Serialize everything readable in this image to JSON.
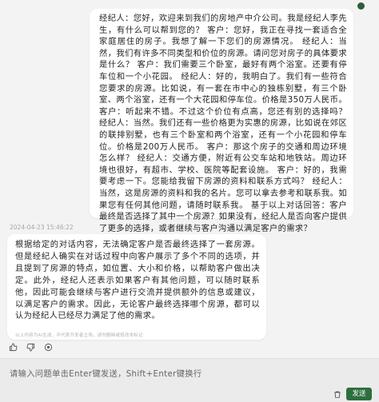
{
  "chat": {
    "user_message": "经纪人：您好，欢迎来到我们的房地产中介公司。我是经纪人李先生，有什么可以帮到您的？ 客户：您好，我正在寻找一套适合全家庭居住的房子。我想了解一下您们的房源情况。 经纪人：当然，我们有许多不同类型和价位的房源。请问您对房子的具体要求是什么？ 客户：我们需要三个卧室，最好有两个浴室。还要有停车位和一个小花园。 经纪人：好的，我明白了。我们有一些符合您要求的房源。比如说，有一套在市中心的独栋别墅，有三个卧室、两个浴室，还有一个大花园和停车位。价格是350万人民币。 客户：听起来不错。不过这个价位有点高，您还有别的选择吗？ 经纪人：当然。我们还有一些价格更为实惠的房源，比如说在郊区的联排别墅，也有三个卧室和两个浴室，还有一个小花园和停车位。价格是200万人民币。 客户：那这个房子的交通和周边环境怎么样？ 经纪人：交通方便，附近有公交车站和地铁站。周边环境也很好，有超市、学校、医院等配套设施。 客户：好的，我需要考虑一下。您能给我留下房源的资料和联系方式吗？ 经纪人：当然，这是房源的资料和我的名片。您可以拿去参考和联系我。如果您有任何其他问题，请随时联系我。 基于以上对话回答：客户最终是否选择了其中一个房源？如果没有，经纪人是否向客户提供了更多的选择，或者继续与客户沟通以满足客户的需求？",
    "timestamp": "2024-04-23 15:46:22",
    "ai_message": "根据给定的对话内容，无法确定客户是否最终选择了一套房源。但是经纪人确实在对话过程中向客户展示了多个不同的选项，并且提到了房源的特点，如位置、大小和价格，以帮助客户做出决定。此外，经纪人还表示如果客户有其他问题，可以随时联系他，因此可能会继续与客户进行交流并提供额外的信息或建议，以满足客户的需求。因此，无论客户最终选择哪个房源，都可以认为经纪人已经尽力满足了他的需求。",
    "disclaimer": "以上内容为AI生成，不代表开发者立场，请勿删除或修改本标记"
  },
  "actions": {
    "icons": [
      "thumbs-up-icon",
      "thumbs-down-icon",
      "stop-icon"
    ]
  },
  "input": {
    "placeholder": "请输入问题单击Enter键发送，Shift+Enter键换行",
    "send_label": "发送"
  },
  "colors": {
    "accent": "#2d6e3e",
    "background": "#f3f3f3",
    "bubble": "#ffffff"
  }
}
